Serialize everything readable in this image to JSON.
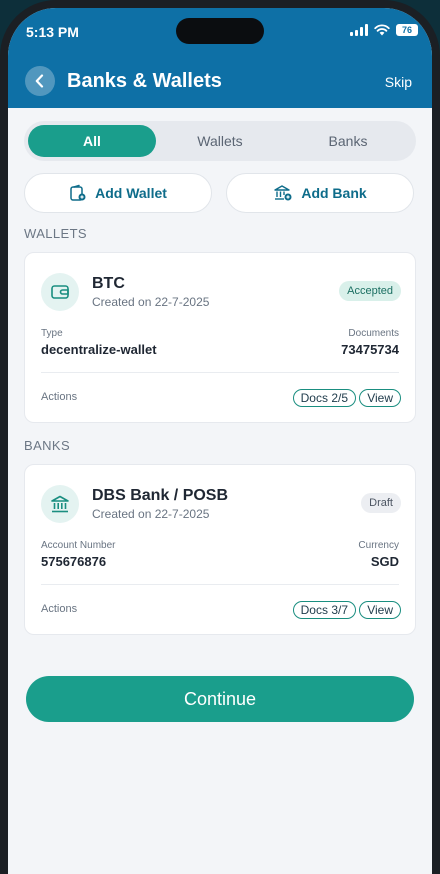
{
  "status_bar": {
    "time": "5:13 PM",
    "battery": "76"
  },
  "header": {
    "title": "Banks & Wallets",
    "skip_label": "Skip"
  },
  "tabs": [
    {
      "label": "All",
      "active": true
    },
    {
      "label": "Wallets",
      "active": false
    },
    {
      "label": "Banks",
      "active": false
    }
  ],
  "add_buttons": {
    "add_wallet": "Add Wallet",
    "add_bank": "Add Bank"
  },
  "sections": {
    "wallets": "WALLETS",
    "banks": "BANKS"
  },
  "wallet_card": {
    "name": "BTC",
    "created": "Created on 22-7-2025",
    "status": "Accepted",
    "type_label": "Type",
    "type_value": "decentralize-wallet",
    "documents_label": "Documents",
    "documents_value": "73475734",
    "actions_label": "Actions",
    "docs_label": "Docs 2/5",
    "view_label": "View"
  },
  "bank_card": {
    "name": "DBS Bank / POSB",
    "created": "Created on 22-7-2025",
    "status": "Draft",
    "account_label": "Account Number",
    "account_value": "575676876",
    "currency_label": "Currency",
    "currency_value": "SGD",
    "actions_label": "Actions",
    "docs_label": "Docs 3/7",
    "view_label": "View"
  },
  "continue_label": "Continue",
  "colors": {
    "header": "#0e70a6",
    "accent": "#1a9e8c",
    "background": "#f3f5f8"
  }
}
